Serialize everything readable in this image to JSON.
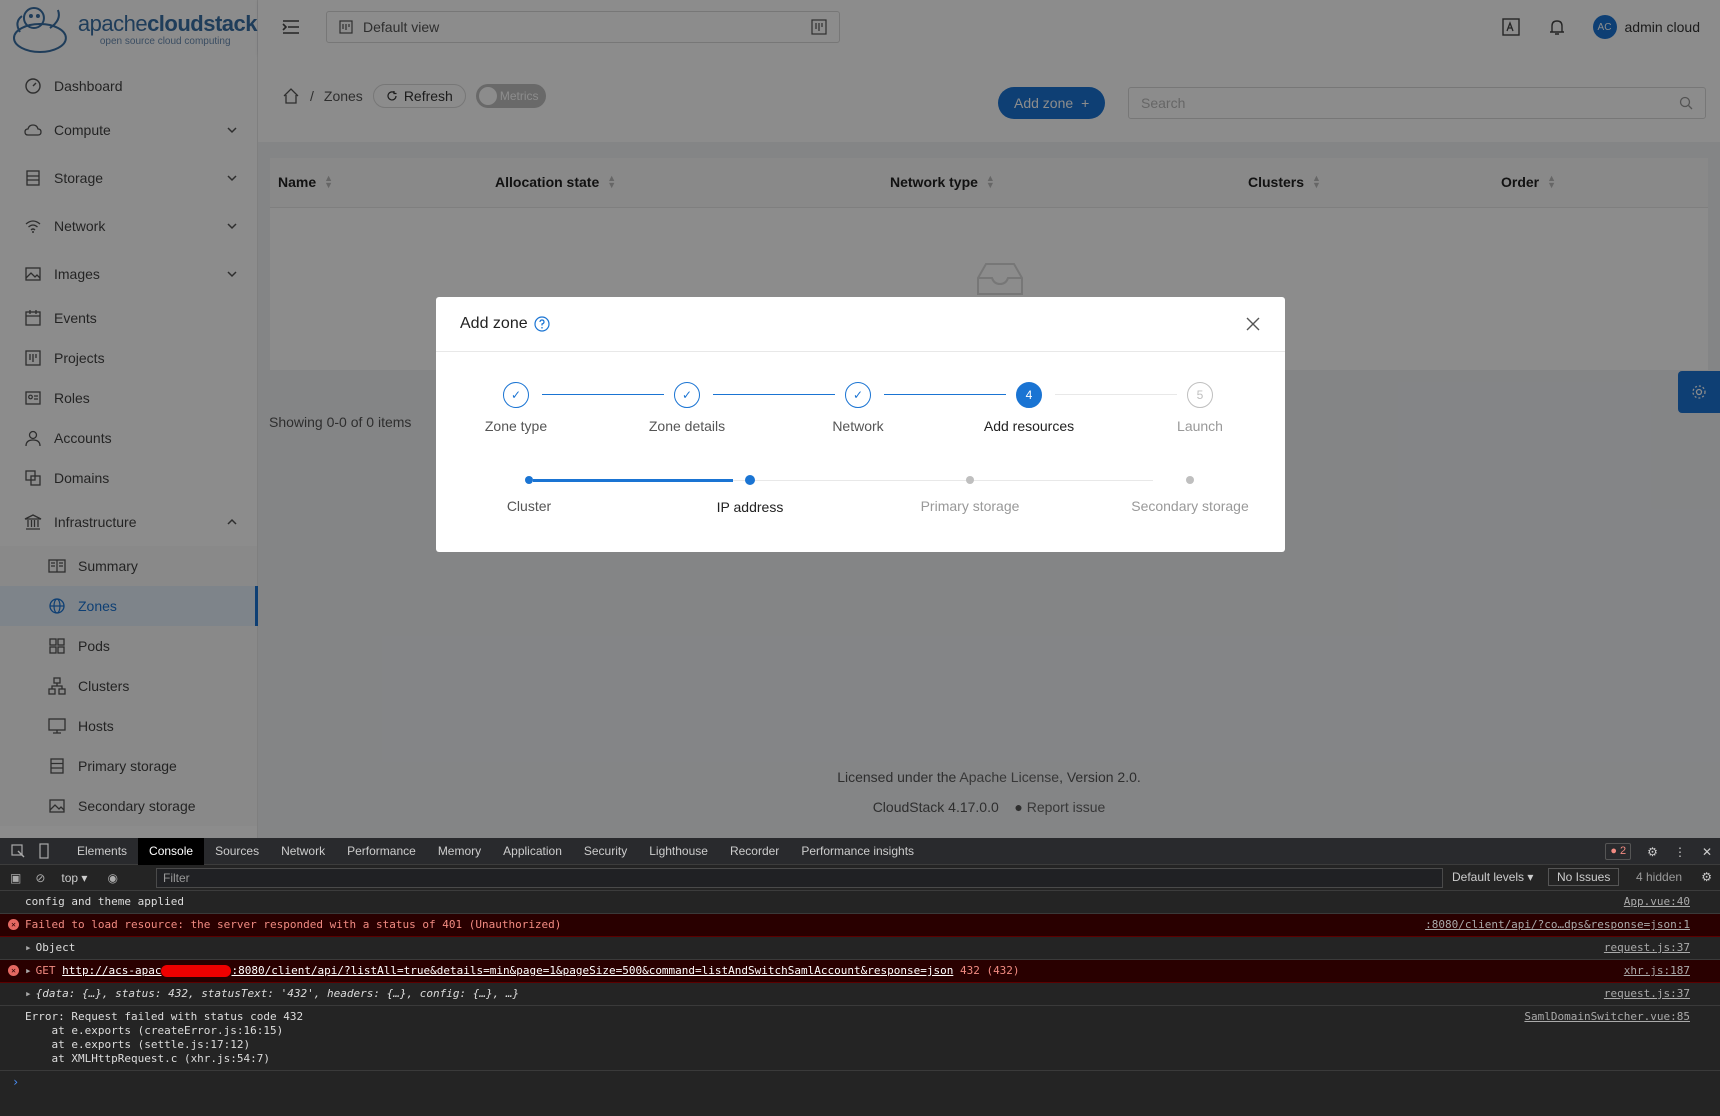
{
  "brand": {
    "name_light": "apache",
    "name_bold": "cloudstack",
    "tagline": "open source cloud computing"
  },
  "header": {
    "view_label": "Default view",
    "user_initials": "AC",
    "user_name": "admin cloud"
  },
  "sidebar": {
    "items": [
      {
        "label": "Dashboard"
      },
      {
        "label": "Compute"
      },
      {
        "label": "Storage"
      },
      {
        "label": "Network"
      },
      {
        "label": "Images"
      },
      {
        "label": "Events"
      },
      {
        "label": "Projects"
      },
      {
        "label": "Roles"
      },
      {
        "label": "Accounts"
      },
      {
        "label": "Domains"
      },
      {
        "label": "Infrastructure"
      }
    ],
    "infra_items": [
      {
        "label": "Summary"
      },
      {
        "label": "Zones"
      },
      {
        "label": "Pods"
      },
      {
        "label": "Clusters"
      },
      {
        "label": "Hosts"
      },
      {
        "label": "Primary storage"
      },
      {
        "label": "Secondary storage"
      }
    ]
  },
  "toolbar": {
    "crumb": "Zones",
    "refresh": "Refresh",
    "metrics": "Metrics",
    "add_zone": "Add zone",
    "search_placeholder": "Search"
  },
  "table": {
    "columns": [
      "Name",
      "Allocation state",
      "Network type",
      "Clusters",
      "Order"
    ],
    "showing": "Showing 0-0 of 0 items"
  },
  "footer": {
    "licensed": "Licensed under the",
    "license_link": "Apache License",
    "version_suffix": ", Version 2.0.",
    "version": "CloudStack 4.17.0.0",
    "report": "Report issue"
  },
  "modal": {
    "title": "Add zone",
    "steps": [
      {
        "label": "Zone type",
        "state": "done"
      },
      {
        "label": "Zone details",
        "state": "done"
      },
      {
        "label": "Network",
        "state": "done"
      },
      {
        "label": "Add resources",
        "state": "current",
        "num": "4"
      },
      {
        "label": "Launch",
        "state": "wait",
        "num": "5"
      }
    ],
    "substeps": [
      {
        "label": "Cluster",
        "state": "done"
      },
      {
        "label": "IP address",
        "state": "current"
      },
      {
        "label": "Primary storage",
        "state": "wait"
      },
      {
        "label": "Secondary storage",
        "state": "wait"
      }
    ]
  },
  "devtools": {
    "tabs": [
      "Elements",
      "Console",
      "Sources",
      "Network",
      "Performance",
      "Memory",
      "Application",
      "Security",
      "Lighthouse",
      "Recorder",
      "Performance insights"
    ],
    "active_tab": "Console",
    "error_count": "2",
    "context": "top",
    "filter_placeholder": "Filter",
    "levels": "Default levels",
    "issues": "No Issues",
    "hidden": "4 hidden",
    "logs": [
      {
        "text": "config and theme applied",
        "src": "App.vue:40",
        "type": "info"
      },
      {
        "text": "Failed to load resource: the server responded with a status of 401 (Unauthorized)",
        "src": ":8080/client/api/?co…dps&response=json:1",
        "type": "error"
      },
      {
        "text": "Object",
        "src": "request.js:37",
        "type": "info"
      },
      {
        "text_prefix": "GET ",
        "url_a": "http://acs-apac",
        "url_b": ":8080/client/api/?listAll=true&details=min&page=1&pageSize=500&command=listAndSwitchSamlAccount&response=json",
        "text_suffix": " 432 (432)",
        "src": "xhr.js:187",
        "type": "error"
      },
      {
        "text": "{data: {…}, status: 432, statusText: '432', headers: {…}, config: {…}, …}",
        "src": "request.js:37",
        "type": "info"
      },
      {
        "text": "Error: Request failed with status code 432\n    at e.exports (createError.js:16:15)\n    at e.exports (settle.js:17:12)\n    at XMLHttpRequest.c (xhr.js:54:7)",
        "src": "SamlDomainSwitcher.vue:85",
        "type": "info"
      }
    ]
  }
}
